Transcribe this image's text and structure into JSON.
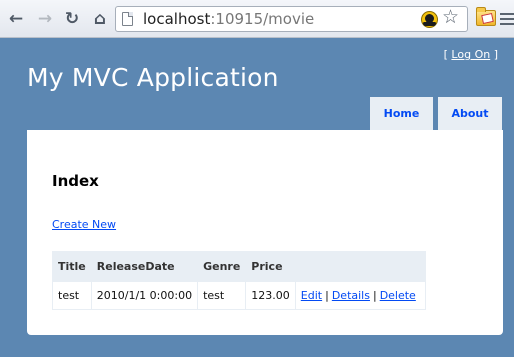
{
  "browser": {
    "url_host": "localhost",
    "url_rest": ":10915/movie"
  },
  "header": {
    "logon_open": "[ ",
    "logon_link": "Log On",
    "logon_close": " ]",
    "site_title": "My MVC Application"
  },
  "menu": {
    "home": "Home",
    "about": "About"
  },
  "main": {
    "heading": "Index",
    "create_link": "Create New",
    "table": {
      "columns": [
        "Title",
        "ReleaseDate",
        "Genre",
        "Price",
        ""
      ],
      "rows": [
        {
          "title": "test",
          "release_date": "2010/1/1 0:00:00",
          "genre": "test",
          "price": "123.00",
          "actions": {
            "edit": "Edit",
            "details": "Details",
            "delete": "Delete",
            "separator": "|"
          }
        }
      ]
    }
  },
  "colors": {
    "page_background": "#5c87b2",
    "menu_background": "#e8eef4",
    "link": "#034af3"
  }
}
